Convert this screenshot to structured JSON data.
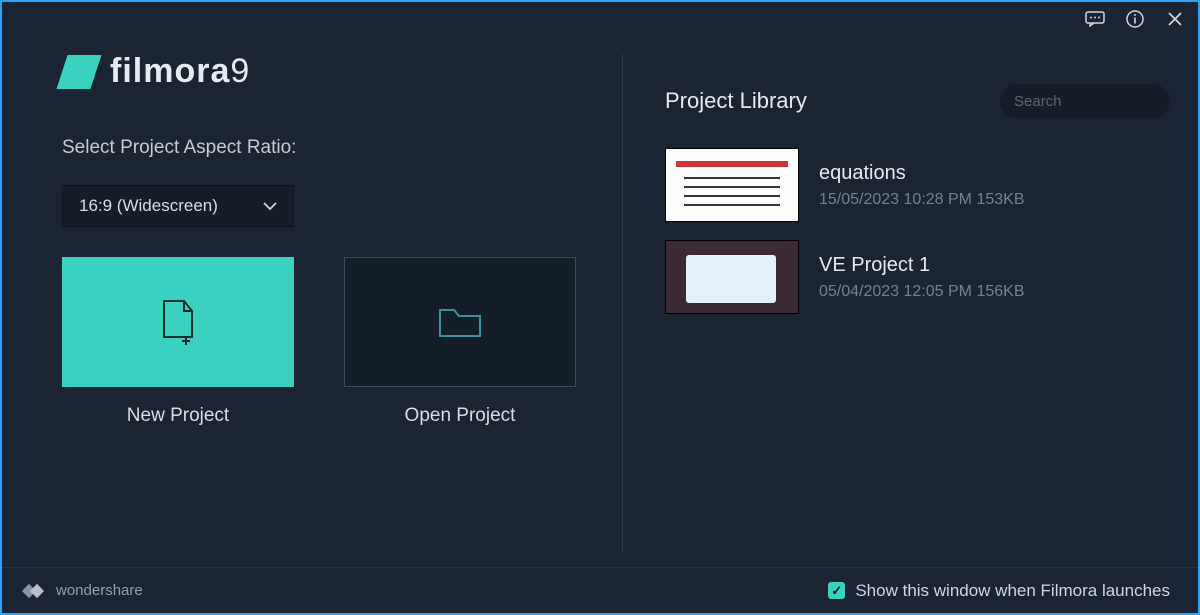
{
  "app": {
    "brand": "filmora",
    "version_suffix": "9",
    "vendor": "wondershare"
  },
  "colors": {
    "accent": "#3ad1c0",
    "bg": "#1a2433",
    "panel": "#141d29"
  },
  "left_panel": {
    "aspect_label": "Select Project Aspect Ratio:",
    "aspect_selected": "16:9 (Widescreen)",
    "new_project_label": "New Project",
    "open_project_label": "Open Project"
  },
  "library": {
    "title": "Project Library",
    "search_placeholder": "Search",
    "projects": [
      {
        "name": "equations",
        "meta": "15/05/2023 10:28 PM 153KB"
      },
      {
        "name": "VE Project 1",
        "meta": "05/04/2023 12:05 PM 156KB"
      }
    ]
  },
  "footer": {
    "show_on_launch_label": "Show this window when Filmora launches",
    "show_on_launch_checked": true
  }
}
